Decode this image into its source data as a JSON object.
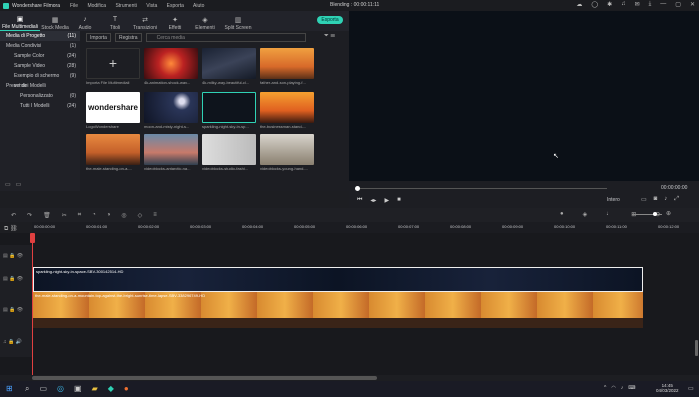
{
  "app": {
    "title": "Wondershare Filmora",
    "window_title": "Blending : 00:00:11:11",
    "menu": [
      "File",
      "Modifica",
      "Strumenti",
      "Vista",
      "Esporta",
      "Aiuto"
    ]
  },
  "toolbar": {
    "tabs": [
      "File Multimediali",
      "Stock Media",
      "Audio",
      "Titoli",
      "Transizioni",
      "Effetti",
      "Elementi",
      "Split Screen"
    ],
    "tab_icons": [
      "▣",
      "▦",
      "♪",
      "T",
      "⇄",
      "✦",
      "◈",
      "▥"
    ],
    "export_label": "Esporta"
  },
  "sidebar": {
    "items": [
      {
        "label": "Media di Progetto",
        "count": "(11)"
      },
      {
        "label": "Media Condivisi",
        "count": "(1)"
      },
      {
        "label": "Sample Color",
        "count": "(24)"
      },
      {
        "label": "Sample Video",
        "count": "(28)"
      },
      {
        "label": "Esempio di schermo verde",
        "count": "(9)"
      },
      {
        "label": "Preset dei Modelli",
        "count": ""
      },
      {
        "label": "Personalizzato",
        "count": "(0)"
      },
      {
        "label": "Tutti I Modelli",
        "count": "(24)"
      }
    ]
  },
  "media": {
    "import_label": "Importa",
    "filter_label": "Registra",
    "search_placeholder": "Cerca media",
    "items": [
      "Importa File Multimediali",
      "4k-animation-shock-wav...",
      "4k-milky-way-beautiful-cl...",
      "father-and-son-playing-f...",
      "LogoWondershare",
      "moon-and-misty-night-s...",
      "sparkling-night-sky-in-sp...",
      "the-businessman-stand-...",
      "the-male-standing-on-a-...",
      "videoblocks-antarctic-na...",
      "videoblocks-studio-fashi...",
      "videoblocks-young-hand-..."
    ],
    "logo_text": "wondershare"
  },
  "preview": {
    "timecode": "00:00:00:00",
    "quality": "Intero"
  },
  "ruler": {
    "ticks": [
      "00:00:00:00",
      "00:00:01:00",
      "00:00:02:00",
      "00:00:03:00",
      "00:00:04:00",
      "00:00:05:00",
      "00:00:06:00",
      "00:00:07:00",
      "00:00:08:00",
      "00:00:09:00",
      "00:00:10:00",
      "00:00:11:00",
      "00:00:12:00"
    ]
  },
  "timeline": {
    "clip1": "sparkling-night-sky-in-space-SBV-300142514-HD",
    "clip2": "the-male-standing-on-a-mountain-top-against-the-bright-sunrise-time-lapse-SBV-338296749-HD"
  },
  "taskbar": {
    "time": "14:45",
    "date": "04/03/2022"
  }
}
